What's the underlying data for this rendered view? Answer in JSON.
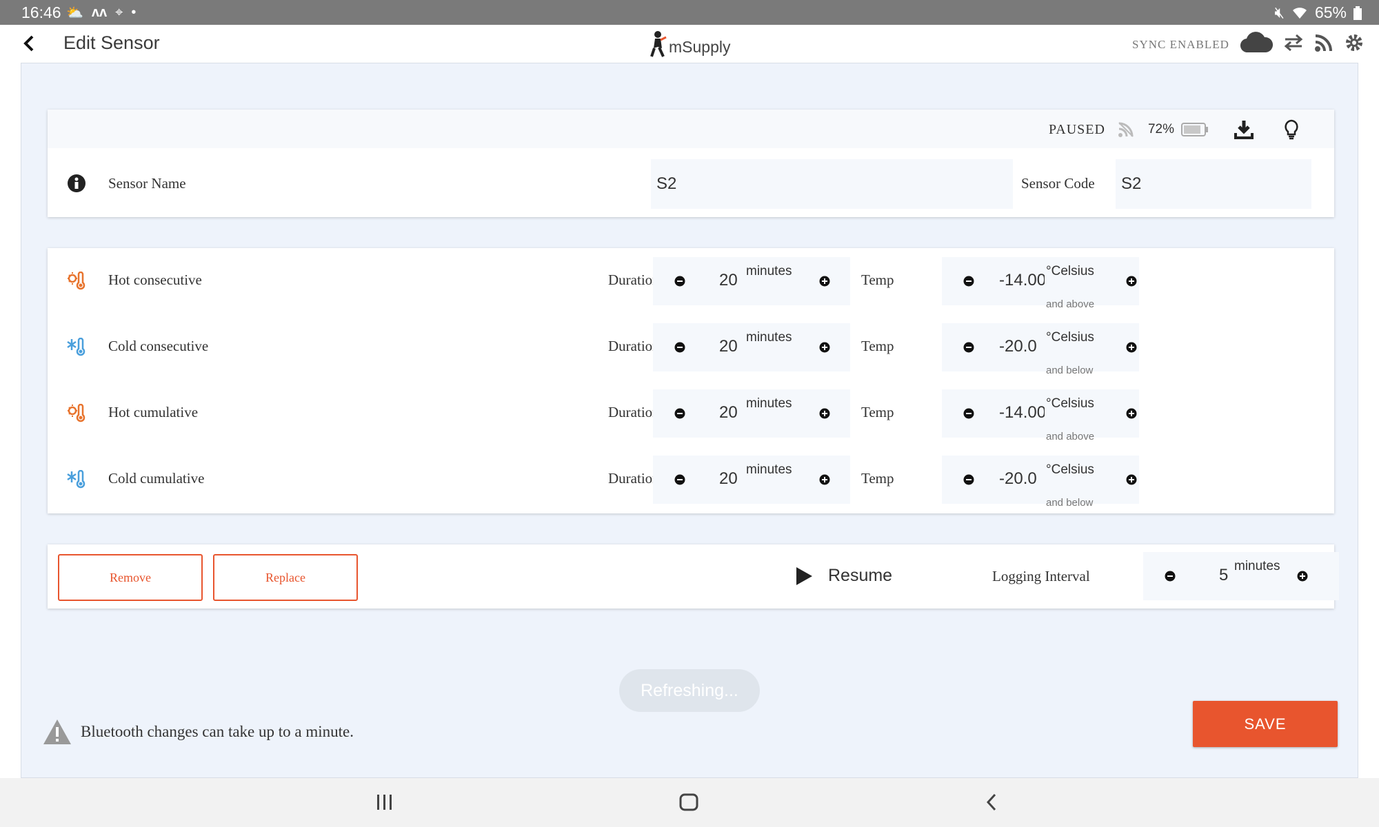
{
  "status_bar": {
    "time": "16:46",
    "battery": "65%"
  },
  "header": {
    "title": "Edit Sensor",
    "brand": "mSupply",
    "sync_status": "SYNC ENABLED"
  },
  "sensor": {
    "state": "PAUSED",
    "battery": "72%",
    "name_label": "Sensor Name",
    "name_value": "S2",
    "code_label": "Sensor Code",
    "code_value": "S2"
  },
  "alerts": [
    {
      "name": "Hot consecutive",
      "type": "hot",
      "duration_label": "Duration",
      "duration": "20",
      "duration_unit": "minutes",
      "temp_label": "Temp",
      "temp": "-14.00",
      "temp_unit": "°Celsius",
      "qualifier": "and above"
    },
    {
      "name": "Cold consecutive",
      "type": "cold",
      "duration_label": "Duration",
      "duration": "20",
      "duration_unit": "minutes",
      "temp_label": "Temp",
      "temp": "-20.0",
      "temp_unit": "°Celsius",
      "qualifier": "and below"
    },
    {
      "name": "Hot cumulative",
      "type": "hot",
      "duration_label": "Duration",
      "duration": "20",
      "duration_unit": "minutes",
      "temp_label": "Temp",
      "temp": "-14.00",
      "temp_unit": "°Celsius",
      "qualifier": "and above"
    },
    {
      "name": "Cold cumulative",
      "type": "cold",
      "duration_label": "Duration",
      "duration": "20",
      "duration_unit": "minutes",
      "temp_label": "Temp",
      "temp": "-20.0",
      "temp_unit": "°Celsius",
      "qualifier": "and below"
    }
  ],
  "actions": {
    "remove_label": "Remove",
    "replace_label": "Replace",
    "resume_label": "Resume",
    "logging_label": "Logging Interval",
    "logging_value": "5",
    "logging_unit": "minutes"
  },
  "footer": {
    "refreshing": "Refreshing...",
    "warning": "Bluetooth changes can take up to a minute.",
    "save_label": "SAVE"
  },
  "colors": {
    "accent": "#e8552e",
    "hot": "#e8742e",
    "cold": "#4a9fdc",
    "background": "#eef3fb"
  }
}
